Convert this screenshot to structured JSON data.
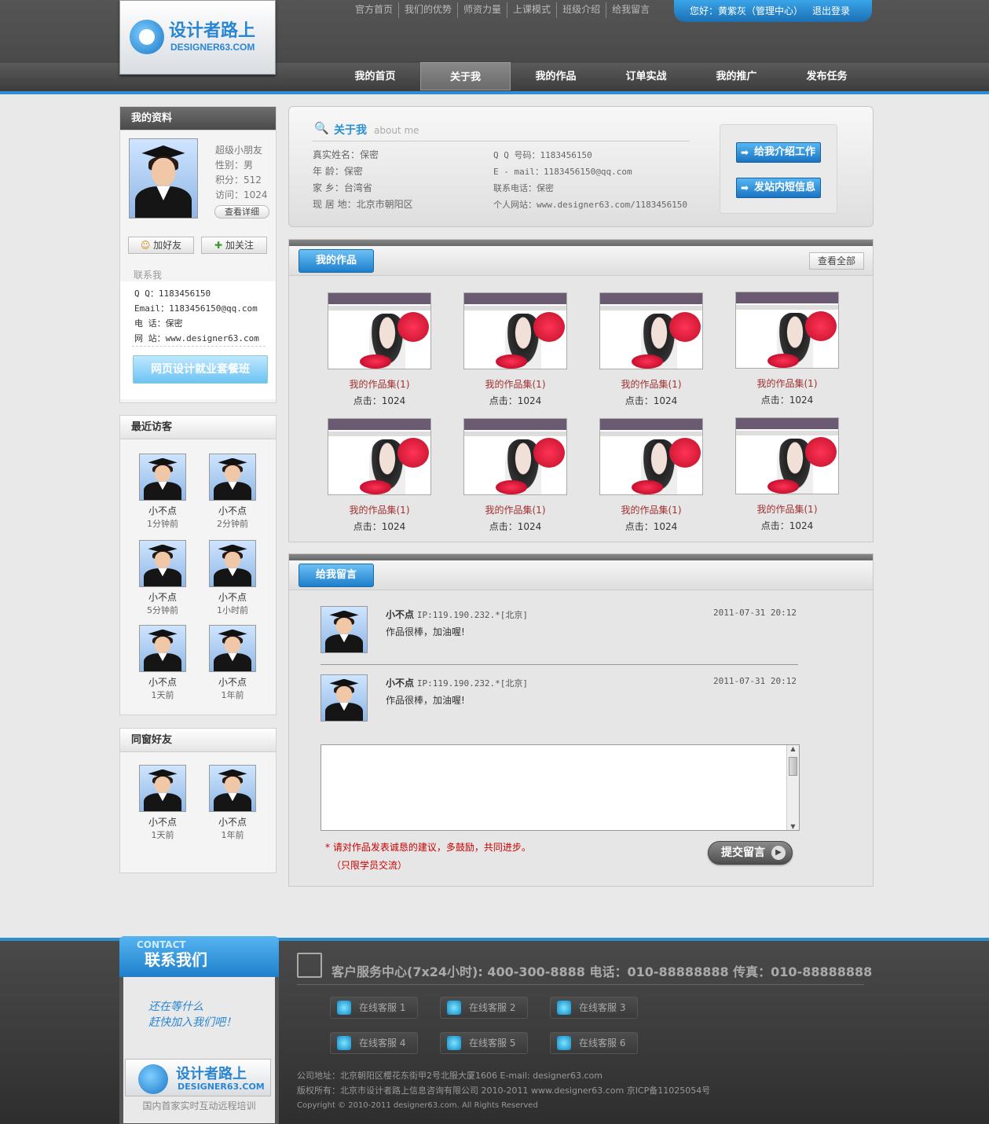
{
  "header": {
    "logo_cn": "设计者路上",
    "logo_en": "DESIGNER63.COM",
    "top_links": [
      "官方首页",
      "我们的优势",
      "师资力量",
      "上课模式",
      "班级介绍",
      "给我留言"
    ],
    "greeting": "您好：黄紫灰（管理中心）",
    "logout": "退出登录",
    "nav": [
      "我的首页",
      "关于我",
      "我的作品",
      "订单实战",
      "我的推广",
      "发布任务"
    ],
    "active_nav": "关于我"
  },
  "profile": {
    "title": "我的资料",
    "name": "超级小朋友",
    "gender": "性别：男",
    "points": "积分：512",
    "visits": "访问：1024",
    "detail_btn": "查看详细",
    "add_friend": "加好友",
    "follow": "加关注",
    "contact_title": "联系我",
    "contact": [
      {
        "label": "Q    Q：",
        "value": "1183456150"
      },
      {
        "label": "Email：",
        "value": "1183456150@qq.com"
      },
      {
        "label": "电  话：",
        "value": "保密"
      },
      {
        "label": "网  站：",
        "value": "www.designer63.com"
      }
    ],
    "course_btn": "网页设计就业套餐班"
  },
  "visitors": {
    "title": "最近访客",
    "items": [
      {
        "name": "小不点",
        "time": "1分钟前"
      },
      {
        "name": "小不点",
        "time": "2分钟前"
      },
      {
        "name": "小不点",
        "time": "5分钟前"
      },
      {
        "name": "小不点",
        "time": "1小时前"
      },
      {
        "name": "小不点",
        "time": "1天前"
      },
      {
        "name": "小不点",
        "time": "1年前"
      }
    ]
  },
  "classmates": {
    "title": "同窗好友",
    "items": [
      {
        "name": "小不点",
        "time": "1天前"
      },
      {
        "name": "小不点",
        "time": "1年前"
      }
    ]
  },
  "about": {
    "title": "关于我",
    "subtitle": "about me",
    "fields": [
      {
        "label": "真实姓名：",
        "value": "保密"
      },
      {
        "label": "年    龄：",
        "value": "保密"
      },
      {
        "label": "家    乡：",
        "value": "台湾省"
      },
      {
        "label": "现 居 地：",
        "value": "北京市朝阳区"
      }
    ],
    "fields_right": [
      {
        "label": "Q Q 号码：",
        "value": "1183456150"
      },
      {
        "label": "E - mail：",
        "value": "1183456150@qq.com"
      },
      {
        "label": "联系电话：",
        "value": "保密"
      },
      {
        "label": "个人网站：",
        "value": "www.designer63.com/1183456150"
      }
    ],
    "btn_intro": "给我介绍工作",
    "btn_msg": "发站内短信息"
  },
  "works": {
    "title": "我的作品",
    "view_all": "查看全部",
    "items": [
      {
        "title": "我的作品集(1)",
        "clicks": "点击：1024"
      },
      {
        "title": "我的作品集(1)",
        "clicks": "点击：1024"
      },
      {
        "title": "我的作品集(1)",
        "clicks": "点击：1024"
      },
      {
        "title": "我的作品集(1)",
        "clicks": "点击：1024"
      },
      {
        "title": "我的作品集(1)",
        "clicks": "点击：1024"
      },
      {
        "title": "我的作品集(1)",
        "clicks": "点击：1024"
      },
      {
        "title": "我的作品集(1)",
        "clicks": "点击：1024"
      },
      {
        "title": "我的作品集(1)",
        "clicks": "点击：1024"
      }
    ]
  },
  "messages": {
    "title": "给我留言",
    "items": [
      {
        "name": "小不点",
        "ip": "IP:119.190.232.*[北京]",
        "text": "作品很棒，加油喔!",
        "date": "2011-07-31 20:12"
      },
      {
        "name": "小不点",
        "ip": "IP:119.190.232.*[北京]",
        "text": "作品很棒，加油喔!",
        "date": "2011-07-31 20:12"
      }
    ],
    "textarea_value": "",
    "note1": "* 请对作品发表诚恳的建议，多鼓励，共同进步。",
    "note2": "（只限学员交流）",
    "submit": "提交留言"
  },
  "footer": {
    "contact_en": "CONTACT",
    "contact_cn": "联系我们",
    "slogan1": "还在等什么",
    "slogan2": "赶快加入我们吧！",
    "logo_cn": "设计者路上",
    "logo_en": "DESIGNER63.COM",
    "tagline": "国内首家实时互动远程培训",
    "service_line": "客户服务中心(7x24小时): 400-300-8888   电话：010-88888888   传真：010-88888888",
    "qq": [
      "在线客服 1",
      "在线客服 2",
      "在线客服 3",
      "在线客服 4",
      "在线客服 5",
      "在线客服 6"
    ],
    "address": "公司地址：北京朝阳区樱花东街甲2号北服大厦1606 E-mail: designer63.com",
    "copyright1": "版权所有：北京市设计者路上信息咨询有限公司 2010-2011 www.designer63.com 京ICP备11025054号",
    "copyright2": "Copyright © 2010-2011 designer63.com. All Rights Reserved"
  },
  "colors": {
    "accent": "#2b8fd2",
    "header_bg": "#4a4a4a",
    "work_title": "#a03030",
    "note_red": "#cc0000"
  }
}
